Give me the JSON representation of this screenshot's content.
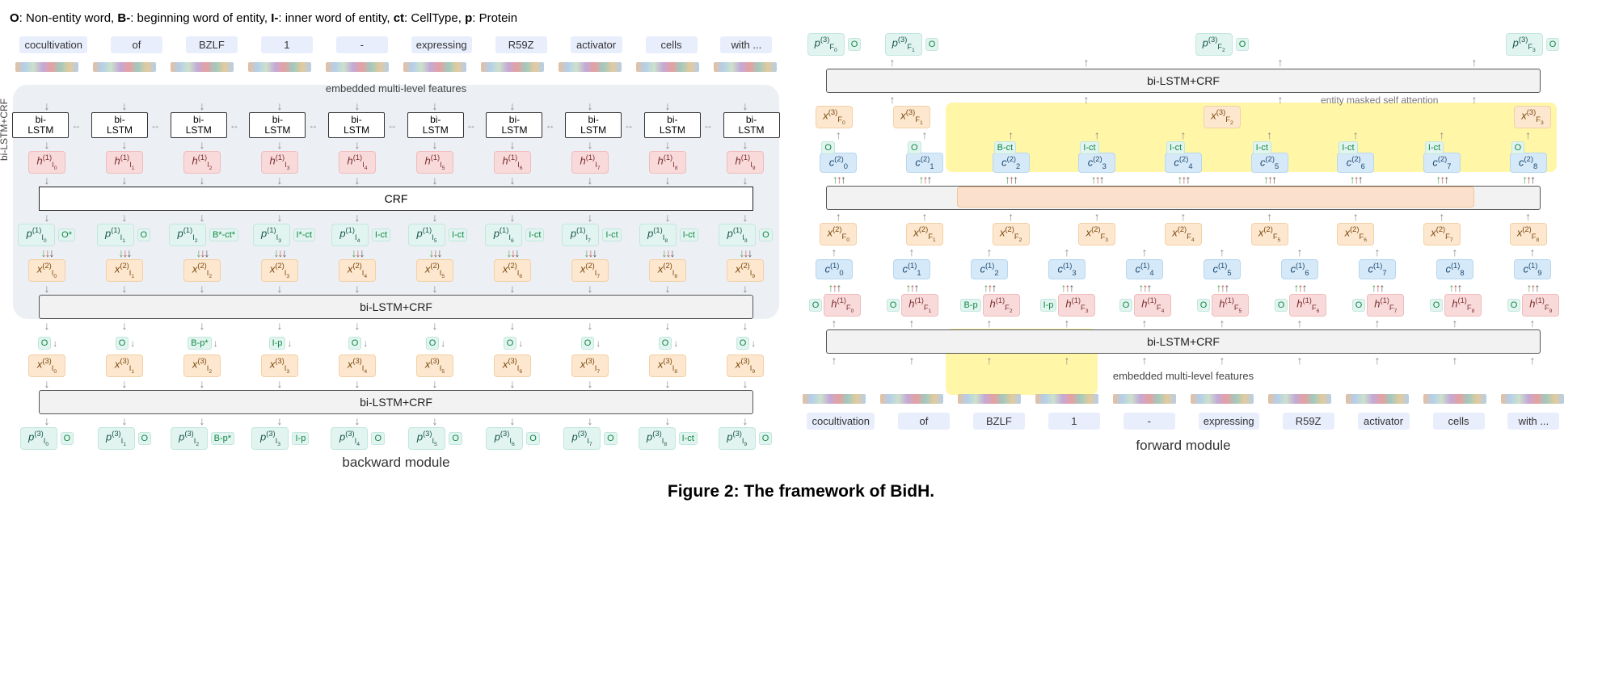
{
  "legend": {
    "o_key": "O",
    "o_txt": ": Non-entity word, ",
    "b_key": "B-",
    "b_txt": ": beginning word of entity, ",
    "i_key": "I-",
    "i_txt": ": inner word of entity, ",
    "ct_key": "ct",
    "ct_txt": ": CellType, ",
    "p_key": "p",
    "p_txt": ": Protein"
  },
  "words": [
    "cocultivation",
    "of",
    "BZLF",
    "1",
    "-",
    "expressing",
    "R59Z",
    "activator",
    "cells",
    "with ..."
  ],
  "labels": {
    "emb": "embedded multi-level features",
    "bilstm": "bi-\nLSTM",
    "bilstmcrf": "bi-LSTM+CRF",
    "crf": "CRF",
    "vert": "bi-LSTM+CRF",
    "backward": "backward module",
    "forward": "forward module",
    "emsa": "entity masked self attention"
  },
  "caption": "Figure 2: The framework of BidH.",
  "left": {
    "h1": [
      "h_{I_0}^{(1)}",
      "h_{I_1}^{(1)}",
      "h_{I_2}^{(1)}",
      "h_{I_3}^{(1)}",
      "h_{I_4}^{(1)}",
      "h_{I_5}^{(1)}",
      "h_{I_6}^{(1)}",
      "h_{I_7}^{(1)}",
      "h_{I_8}^{(1)}",
      "h_{I_9}^{(1)}"
    ],
    "p1": [
      "p_{I_0}^{(1)}",
      "p_{I_1}^{(1)}",
      "p_{I_2}^{(1)}",
      "p_{I_3}^{(1)}",
      "p_{I_4}^{(1)}",
      "p_{I_5}^{(1)}",
      "p_{I_6}^{(1)}",
      "p_{I_7}^{(1)}",
      "p_{I_8}^{(1)}",
      "p_{I_9}^{(1)}"
    ],
    "p1t": [
      "O*",
      "O",
      "B*-ct*",
      "I*-ct",
      "I-ct",
      "I-ct",
      "I-ct",
      "I-ct",
      "I-ct",
      "O"
    ],
    "x2": [
      "x_{I_0}^{(2)}",
      "x_{I_1}^{(2)}",
      "x_{I_2}^{(2)}",
      "x_{I_3}^{(2)}",
      "x_{I_4}^{(2)}",
      "x_{I_5}^{(2)}",
      "x_{I_6}^{(2)}",
      "x_{I_7}^{(2)}",
      "x_{I_8}^{(2)}",
      "x_{I_9}^{(2)}"
    ],
    "o2": [
      "O",
      "O",
      "B-p*",
      "I-p",
      "O",
      "O",
      "O",
      "O",
      "O",
      "O"
    ],
    "x3": [
      "x_{I_0}^{(3)}",
      "x_{I_1}^{(3)}",
      "x_{I_2}^{(3)}",
      "x_{I_3}^{(3)}",
      "x_{I_4}^{(3)}",
      "x_{I_5}^{(3)}",
      "x_{I_6}^{(3)}",
      "x_{I_7}^{(3)}",
      "x_{I_8}^{(3)}",
      "x_{I_9}^{(3)}"
    ],
    "p3": [
      "p_{I_0}^{(3)}",
      "p_{I_1}^{(3)}",
      "p_{I_2}^{(3)}",
      "p_{I_3}^{(3)}",
      "p_{I_4}^{(3)}",
      "p_{I_5}^{(3)}",
      "p_{I_6}^{(3)}",
      "p_{I_7}^{(3)}",
      "p_{I_8}^{(3)}",
      "p_{I_9}^{(3)}"
    ],
    "p3t": [
      "O",
      "O",
      "B-p*",
      "I-p",
      "O",
      "O",
      "O",
      "O",
      "I-ct",
      "O"
    ]
  },
  "right": {
    "top_p": [
      "p_{F_0}^{(3)}",
      "p_{F_1}^{(3)}",
      "p_{F_2}^{(3)}",
      "p_{F_3}^{(3)}"
    ],
    "top_t": [
      "O",
      "O",
      "O",
      "O"
    ],
    "x3": [
      "x_{F_0}^{(3)}",
      "x_{F_1}^{(3)}",
      "x_{F_2}^{(3)}",
      "x_{F_3}^{(3)}"
    ],
    "c2": [
      "c_0^{(2)}",
      "c_1^{(2)}",
      "c_2^{(2)}",
      "c_3^{(2)}",
      "c_4^{(2)}",
      "c_5^{(2)}",
      "c_6^{(2)}",
      "c_7^{(2)}",
      "c_8^{(2)}"
    ],
    "c2t": [
      "O",
      "O",
      "B-ct",
      "I-ct",
      "I-ct",
      "I-ct",
      "I-ct",
      "I-ct",
      "O"
    ],
    "x2": [
      "x_{F_0}^{(2)}",
      "x_{F_1}^{(2)}",
      "x_{F_2}^{(2)}",
      "x_{F_3}^{(2)}",
      "x_{F_4}^{(2)}",
      "x_{F_5}^{(2)}",
      "x_{F_6}^{(2)}",
      "x_{F_7}^{(2)}",
      "x_{F_8}^{(2)}"
    ],
    "c1": [
      "c_0^{(1)}",
      "c_1^{(1)}",
      "c_2^{(1)}",
      "c_3^{(1)}",
      "c_4^{(1)}",
      "c_5^{(1)}",
      "c_6^{(1)}",
      "c_7^{(1)}",
      "c_8^{(1)}",
      "c_9^{(1)}"
    ],
    "h1": [
      "h_{F_0}^{(1)}",
      "h_{F_1}^{(1)}",
      "h_{F_2}^{(1)}",
      "h_{F_3}^{(1)}",
      "h_{F_4}^{(1)}",
      "h_{F_5}^{(1)}",
      "h_{F_6}^{(1)}",
      "h_{F_7}^{(1)}",
      "h_{F_8}^{(1)}",
      "h_{F_9}^{(1)}"
    ],
    "h1t": [
      "O",
      "O",
      "B-p",
      "I-p",
      "O",
      "O",
      "O",
      "O",
      "O",
      "O"
    ]
  }
}
